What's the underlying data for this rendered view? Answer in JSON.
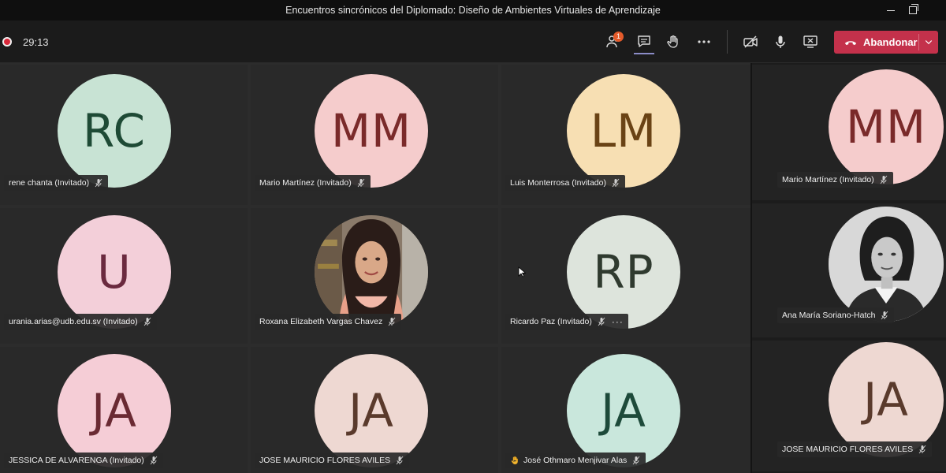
{
  "window": {
    "title": "Encuentros sincrónicos del Diplomado: Diseño de Ambientes Virtuales de Aprendizaje"
  },
  "toolbar": {
    "recording_timer": "29:13",
    "participants_badge": "1",
    "leave_label": "Abandonar"
  },
  "colors": {
    "leave_red": "#c4314b",
    "recording_red": "#d8283a",
    "badge_orange": "#e45a2a"
  },
  "participants": [
    {
      "initials": "RC",
      "name": "rene chanta (Invitado)",
      "bg": "#c8e3d4",
      "fg": "#1e4a35"
    },
    {
      "initials": "MM",
      "name": "Mario Martínez (Invitado)",
      "bg": "#f5cccc",
      "fg": "#7a2a2a"
    },
    {
      "initials": "LM",
      "name": "Luis Monterrosa (Invitado)",
      "bg": "#f7dfb3",
      "fg": "#6a4315"
    },
    {
      "initials": "U",
      "name": "urania.arias@udb.edu.sv (Invitado)",
      "bg": "#f3cfd9",
      "fg": "#6a2a3f"
    },
    {
      "initials": "",
      "name": "Roxana Elizabeth Vargas Chavez",
      "bg": "#7a6a5e",
      "fg": "#ffffff"
    },
    {
      "initials": "RP",
      "name": "Ricardo Paz (Invitado)",
      "bg": "#dde4dc",
      "fg": "#2f3a2f"
    },
    {
      "initials": "JA",
      "name": "JESSICA DE ALVARENGA (Invitado)",
      "bg": "#f5cdd6",
      "fg": "#6a2a33"
    },
    {
      "initials": "JA",
      "name": "JOSE MAURICIO FLORES AVILES",
      "bg": "#eed8d2",
      "fg": "#5a3a2c"
    },
    {
      "initials": "JA",
      "name": "José Othmaro Menjivar Alas",
      "bg": "#c9e7dc",
      "fg": "#1d4a3a"
    }
  ],
  "side_participants": [
    {
      "initials": "MM",
      "name": "Mario Martínez (Invitado)",
      "bg": "#f5cccc",
      "fg": "#7a2a2a"
    },
    {
      "initials": "",
      "name": "Ana María Soriano-Hatch",
      "bg": "#bdbdbd",
      "fg": "#222222"
    },
    {
      "initials": "JA",
      "name": "JOSE MAURICIO FLORES AVILES",
      "bg": "#eed8d2",
      "fg": "#5a3a2c"
    }
  ]
}
